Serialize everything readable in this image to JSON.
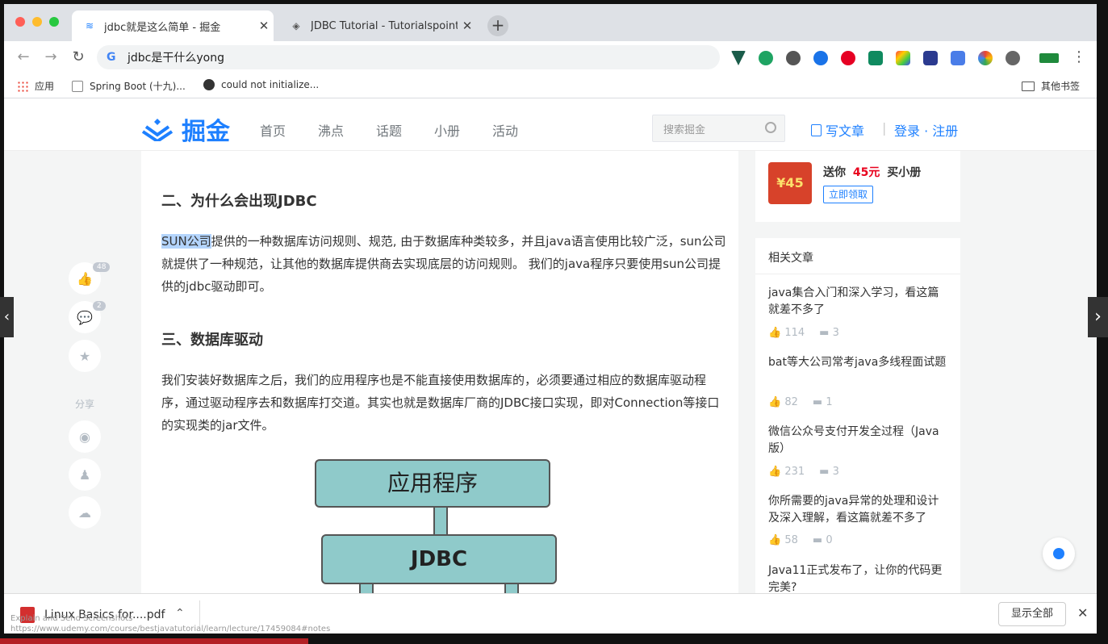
{
  "browser": {
    "tabs": [
      {
        "title": "jdbc就是这么简单 - 掘金",
        "active": true
      },
      {
        "title": "JDBC Tutorial - Tutorialspoint",
        "active": false
      }
    ],
    "address": "jdbc是干什么yong",
    "bookmarks": [
      {
        "label": "应用"
      },
      {
        "label": "Spring Boot (十九)..."
      },
      {
        "label": "could not initialize..."
      }
    ],
    "other_bookmarks": "其他书签"
  },
  "site": {
    "logo_text": "掘金",
    "nav": [
      "首页",
      "沸点",
      "话题",
      "小册",
      "活动"
    ],
    "search_placeholder": "搜索掘金",
    "write_label": "写文章",
    "login_label": "登录 · 注册"
  },
  "article": {
    "heading_1": "二、为什么会出现JDBC",
    "p1_highlight": "SUN公司",
    "p1_rest": "提供的一种数据库访问规则、规范, 由于数据库种类较多，并且java语言使用比较广泛，sun公司就提供了一种规范，让其他的数据库提供商去实现底层的访问规则。 我们的java程序只要使用sun公司提供的jdbc驱动即可。",
    "heading_2": "三、数据库驱动",
    "p2": "我们安装好数据库之后，我们的应用程序也是不能直接使用数据库的，必须要通过相应的数据库驱动程序，通过驱动程序去和数据库打交道。其实也就是数据库厂商的JDBC接口实现，即对Connection等接口的实现类的jar文件。",
    "diagram": {
      "box_top": "应用程序",
      "box_mid": "JDBC"
    }
  },
  "sticky": {
    "like_count": "48",
    "comment_count": "2",
    "share_label": "分享"
  },
  "promo": {
    "price_tag": "¥45",
    "text_prefix": "送你",
    "amount": "45元",
    "text_suffix": "买小册",
    "button": "立即领取"
  },
  "related": {
    "title": "相关文章",
    "items": [
      {
        "title": "java集合入门和深入学习，看这篇就差不多了",
        "likes": "114",
        "comments": "3"
      },
      {
        "title": "bat等大公司常考java多线程面试题",
        "likes": "82",
        "comments": "1"
      },
      {
        "title": "微信公众号支付开发全过程（Java版）",
        "likes": "231",
        "comments": "3"
      },
      {
        "title": "你所需要的java异常的处理和设计及深入理解，看这篇就差不多了",
        "likes": "58",
        "comments": "0"
      },
      {
        "title": "Java11正式发布了，让你的代码更完美?",
        "likes": "",
        "comments": ""
      }
    ]
  },
  "download": {
    "file": "Linux Basics for....pdf",
    "show_all": "显示全部"
  },
  "overlay": {
    "line1": "Explain and Send Screenshots",
    "line2": "https://www.udemy.com/course/bestjavatutorial/learn/lecture/17459084#notes"
  },
  "colors": {
    "accent": "#1e80ff",
    "price_red": "#e8001c",
    "diagram_fill": "#8fcaca"
  }
}
